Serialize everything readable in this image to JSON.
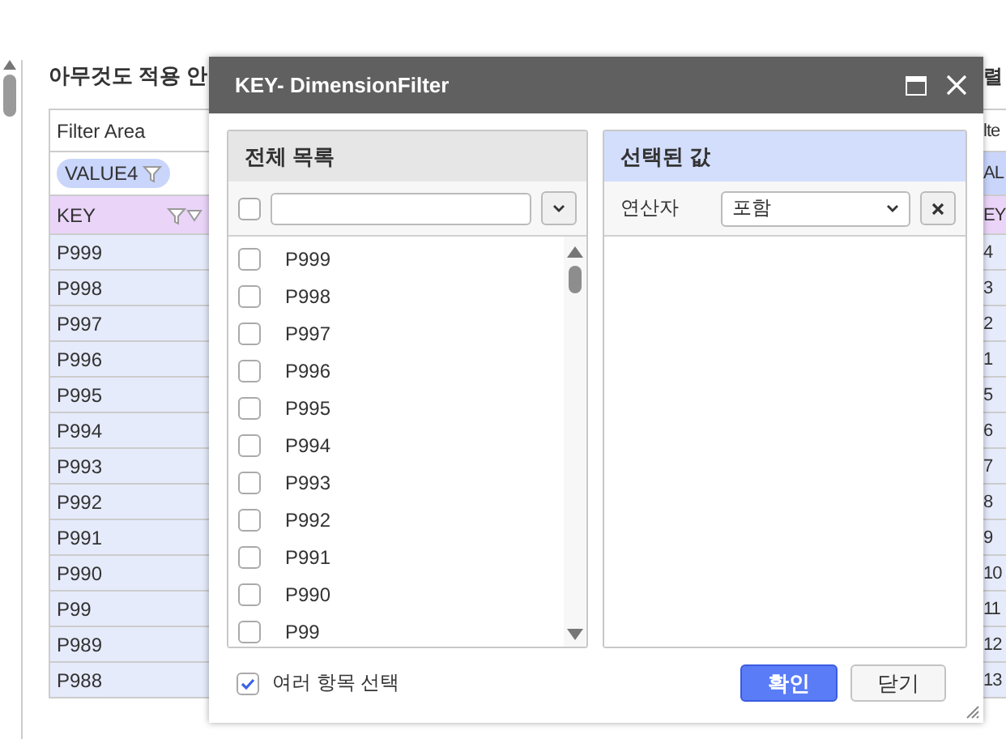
{
  "background": {
    "heading": "아무것도 적용 안",
    "filter_label": "Filter Area",
    "chips": [
      "VALUE4"
    ],
    "key_header": "KEY",
    "rows": [
      {
        "key": "P999"
      },
      {
        "key": "P998"
      },
      {
        "key": "P997"
      },
      {
        "key": "P996"
      },
      {
        "key": "P995"
      },
      {
        "key": "P994"
      },
      {
        "key": "P993"
      },
      {
        "key": "P992"
      },
      {
        "key": "P991"
      },
      {
        "key": "P990"
      },
      {
        "key": "P99"
      },
      {
        "key": "P989"
      },
      {
        "key": "P988"
      }
    ],
    "right_table": {
      "heading": "렬",
      "filter_label": "lte",
      "chip": "AL",
      "header": "EY",
      "rows": [
        "4",
        "3",
        "2",
        "1",
        "5",
        "6",
        "7",
        "8",
        "9",
        "10",
        "11",
        "12",
        "13"
      ]
    }
  },
  "dialog": {
    "title": "KEY- DimensionFilter",
    "left_panel": {
      "title": "전체 목록",
      "select_all": {
        "checked": false
      },
      "items": [
        {
          "label": "P999",
          "checked": false
        },
        {
          "label": "P998",
          "checked": false
        },
        {
          "label": "P997",
          "checked": false
        },
        {
          "label": "P996",
          "checked": false
        },
        {
          "label": "P995",
          "checked": false
        },
        {
          "label": "P994",
          "checked": false
        },
        {
          "label": "P993",
          "checked": false
        },
        {
          "label": "P992",
          "checked": false
        },
        {
          "label": "P991",
          "checked": false
        },
        {
          "label": "P990",
          "checked": false
        },
        {
          "label": "P99",
          "checked": false
        }
      ]
    },
    "right_panel": {
      "title": "선택된 값",
      "operator_label": "연산자",
      "operator_value": "포함"
    },
    "multi_select": {
      "label": "여러 항목 선택",
      "checked": true
    },
    "buttons": [
      {
        "label": "확인",
        "kind": "primary"
      },
      {
        "label": "닫기",
        "kind": "secondary"
      }
    ]
  }
}
